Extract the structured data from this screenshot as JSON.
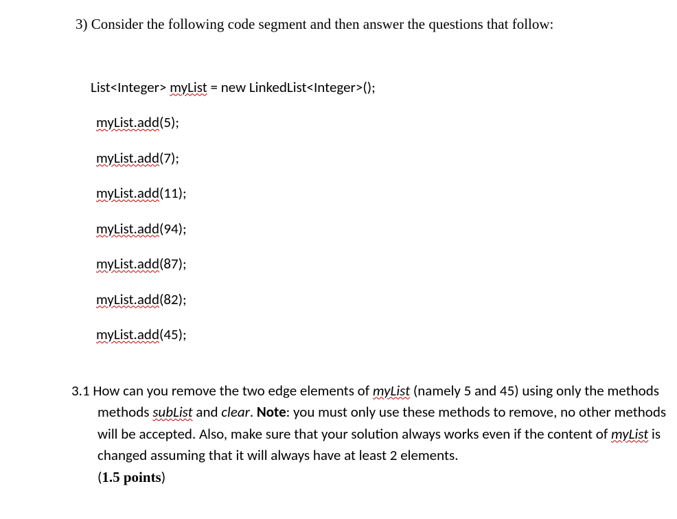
{
  "question": {
    "number": "3)",
    "intro": "Consider the following code segment and then answer the questions that follow:"
  },
  "code": {
    "decl_prefix": "List<Integer> ",
    "decl_var": "myList",
    "decl_suffix": " = new LinkedList<Integer>();",
    "lines": [
      {
        "call": "myList.add",
        "arg": "(5);"
      },
      {
        "call": "myList.add",
        "arg": "(7);"
      },
      {
        "call": "myList.add",
        "arg": "(11);"
      },
      {
        "call": "myList.add",
        "arg": "(94);"
      },
      {
        "call": "myList.add",
        "arg": "(87);"
      },
      {
        "call": "myList.add",
        "arg": "(82);"
      },
      {
        "call": "myList.add",
        "arg": "(45);"
      }
    ]
  },
  "subquestion": {
    "number": "3.1",
    "t1": " How can you remove the two edge elements of  ",
    "v1": "myList",
    "t2": " (namely 5 and 45) using only the methods ",
    "v2": "subList",
    "t3": " and ",
    "v3": "clear",
    "t4": ".  ",
    "note_label": "Note",
    "t5": ": you must only use these methods to remove, no other methods will be accepted.   Also, make sure that your solution always works even if the content of ",
    "v4": "myList",
    "t6": " is changed assuming that it will always have at least 2 elements.",
    "points_open": "(",
    "points_text": "1.5 points",
    "points_close": ")"
  }
}
